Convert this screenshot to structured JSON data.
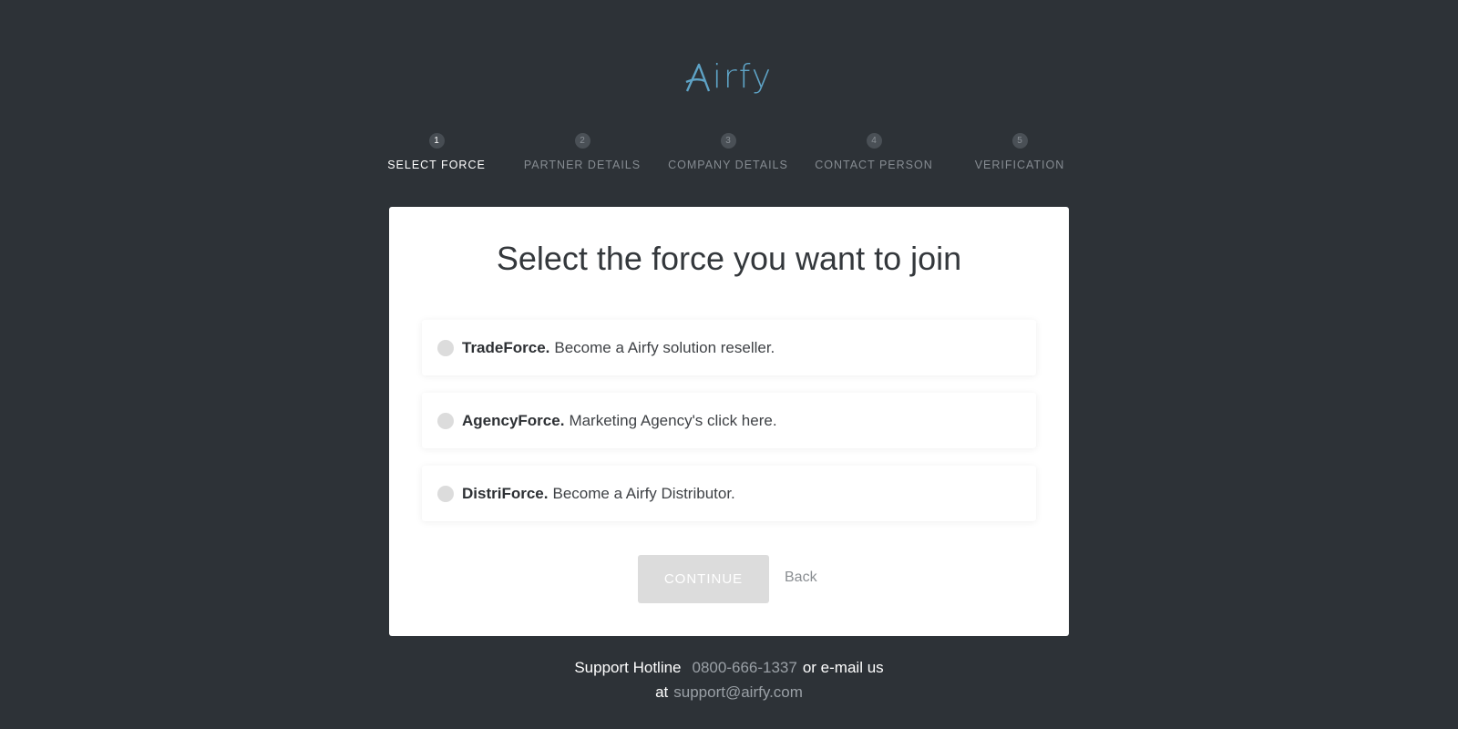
{
  "brand": {
    "name": "irfy",
    "logo_alt": "Airfy",
    "accent_color": "#5ea3c6",
    "logo_icon": "airfy-a-logo-icon"
  },
  "steps": [
    {
      "number": "1",
      "label": "SELECT FORCE",
      "active": true
    },
    {
      "number": "2",
      "label": "PARTNER DETAILS",
      "active": false
    },
    {
      "number": "3",
      "label": "COMPANY DETAILS",
      "active": false
    },
    {
      "number": "4",
      "label": "CONTACT PERSON",
      "active": false
    },
    {
      "number": "5",
      "label": "VERIFICATION",
      "active": false
    }
  ],
  "card": {
    "title": "Select the force you want to join",
    "options": [
      {
        "name": "TradeForce.",
        "description": "Become a Airfy solution reseller.",
        "selected": false
      },
      {
        "name": "AgencyForce.",
        "description": "Marketing Agency's click here.",
        "selected": false
      },
      {
        "name": "DistriForce.",
        "description": "Become a Airfy Distributor.",
        "selected": false
      }
    ],
    "continue_label": "CONTINUE",
    "back_label": "Back"
  },
  "footer": {
    "hotline_label": "Support Hotline",
    "hotline_number": "0800-666-1337",
    "or_email": "or e-mail us",
    "at": "at",
    "email": "support@airfy.com"
  },
  "colors": {
    "background": "#2d3237",
    "card": "#ffffff",
    "disabled_button": "#dcdcdc"
  }
}
